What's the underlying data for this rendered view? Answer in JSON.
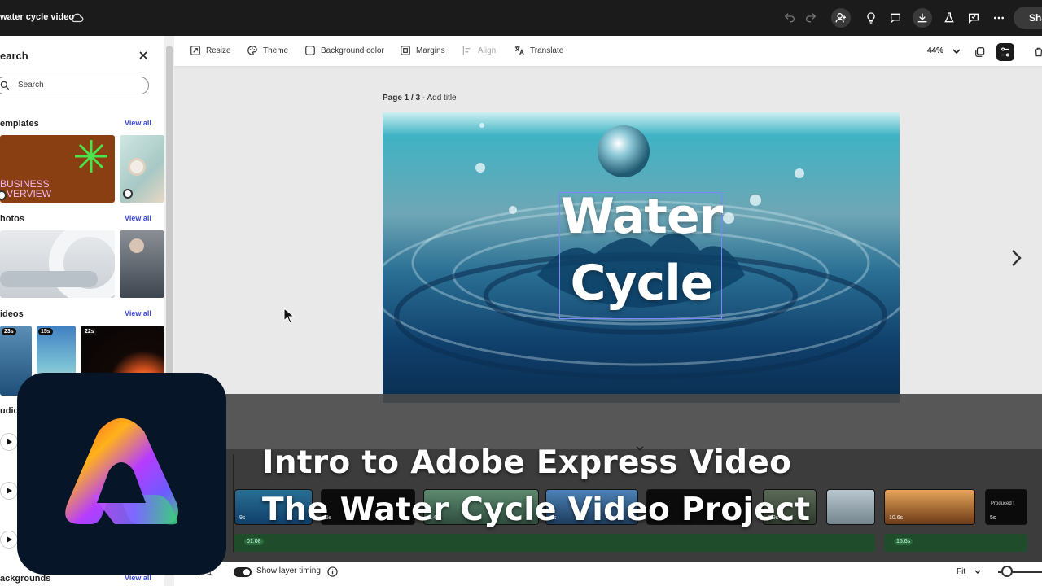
{
  "header": {
    "doc_title": "water cycle video",
    "share_label": "Sha"
  },
  "left_panel": {
    "title": "earch",
    "search_placeholder": "Search",
    "sections": {
      "templates": {
        "label": "emplates",
        "view_all": "View all"
      },
      "photos": {
        "label": "hotos",
        "view_all": "View all"
      },
      "videos": {
        "label": "ideos",
        "view_all": "View all"
      },
      "audio": {
        "label": "udio"
      },
      "backgrounds": {
        "label": "ackgrounds",
        "view_all": "View all"
      }
    },
    "template_text": [
      "BUSINESS",
      "VERVIEW"
    ],
    "video_durations": [
      "23s",
      "15s",
      "22s"
    ]
  },
  "toolbar": {
    "resize": "Resize",
    "theme": "Theme",
    "background_color": "Background color",
    "margins": "Margins",
    "align": "Align",
    "translate": "Translate",
    "zoom": "44%"
  },
  "canvas": {
    "page_indicator": "Page 1 / 3",
    "add_title": "Add title",
    "slide_title_line1": "Water",
    "slide_title_line2": "Cycle"
  },
  "timeline": {
    "clips": [
      {
        "duration": "9s"
      },
      {
        "duration": "5s"
      },
      {
        "duration": "5.4s"
      },
      {
        "duration": "5s"
      },
      {
        "duration": "5s"
      },
      {
        "duration": "5.9s"
      },
      {
        "duration": "10.6s"
      },
      {
        "duration": "5s",
        "label": "Produced t"
      }
    ],
    "audio_times": [
      "01:08",
      "15.6s"
    ]
  },
  "bottom_bar": {
    "time": ":24",
    "show_layer_timing": "Show layer timing",
    "fit": "Fit"
  },
  "overlay": {
    "line1": "Intro to Adobe Express Video",
    "line2": "The Water Cycle Video Project"
  },
  "colors": {
    "topbar": "#1b1b1b",
    "accent_link": "#3d4bd6",
    "logo_bg": "#061628",
    "audio_track": "#1f4d2c"
  }
}
